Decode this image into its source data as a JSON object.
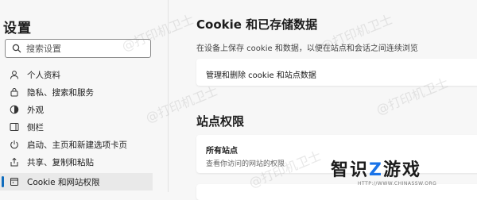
{
  "sidebar": {
    "title": "设置",
    "search_placeholder": "搜索设置",
    "items": [
      {
        "label": "个人资料",
        "icon": "profile-icon"
      },
      {
        "label": "隐私、搜索和服务",
        "icon": "lock-icon"
      },
      {
        "label": "外观",
        "icon": "appearance-icon"
      },
      {
        "label": "侧栏",
        "icon": "sidebar-icon"
      },
      {
        "label": "启动、主页和新建选项卡页",
        "icon": "power-icon"
      },
      {
        "label": "共享、复制和粘贴",
        "icon": "share-icon"
      },
      {
        "label": "Cookie 和网站权限",
        "icon": "cookie-icon",
        "active": true
      }
    ]
  },
  "main": {
    "section_title": "Cookie 和已存储数据",
    "section_desc": "在设备上保存 cookie 和数据，以便在站点和会话之间连续浏览",
    "manage_cookies_label": "管理和删除 cookie 和站点数据",
    "permissions_title": "站点权限",
    "all_sites_title": "所有站点",
    "all_sites_desc": "查看你访问的网站的权限"
  },
  "watermark": "@打印机卫士",
  "logo": {
    "brand_part1": "智识",
    "brand_z": "Z",
    "brand_part2": "游戏",
    "url": "HTTP://WWW.CHINASSW.ORG"
  },
  "colors": {
    "accent": "#0f6cbd",
    "logo_blue": "#1a73e8"
  }
}
